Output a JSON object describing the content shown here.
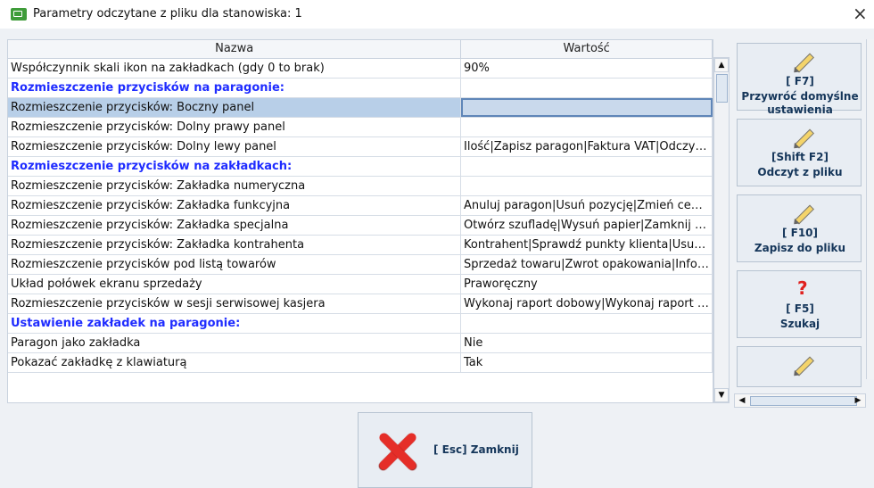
{
  "window": {
    "title": "Parametry odczytane z pliku dla stanowiska: 1",
    "close_label": "×"
  },
  "table": {
    "headers": [
      "Nazwa",
      "Wartość"
    ],
    "rows": [
      {
        "name": "Współczynnik skali ikon na zakładkach (gdy 0 to brak)",
        "value": "90%",
        "section": false,
        "selected": false
      },
      {
        "name": "Rozmieszczenie przycisków na paragonie:",
        "value": "",
        "section": true,
        "selected": false
      },
      {
        "name": "Rozmieszczenie przycisków: Boczny panel",
        "value": "",
        "section": false,
        "selected": true
      },
      {
        "name": "Rozmieszczenie przycisków: Dolny prawy panel",
        "value": "",
        "section": false,
        "selected": false
      },
      {
        "name": "Rozmieszczenie przycisków: Dolny lewy panel",
        "value": "Ilość|Zapisz paragon|Faktura VAT|Odczyt...",
        "section": false,
        "selected": false
      },
      {
        "name": "Rozmieszczenie przycisków na zakładkach:",
        "value": "",
        "section": true,
        "selected": false
      },
      {
        "name": "Rozmieszczenie przycisków: Zakładka numeryczna",
        "value": "",
        "section": false,
        "selected": false
      },
      {
        "name": "Rozmieszczenie przycisków: Zakładka funkcyjna",
        "value": "Anuluj paragon|Usuń pozycję|Zmień cen...",
        "section": false,
        "selected": false
      },
      {
        "name": "Rozmieszczenie przycisków: Zakładka specjalna",
        "value": "Otwórz szufladę|Wysuń papier|Zamknij z...",
        "section": false,
        "selected": false
      },
      {
        "name": "Rozmieszczenie przycisków: Zakładka kontrahenta",
        "value": "Kontrahent|Sprawdź punkty klienta|Usuń ...",
        "section": false,
        "selected": false
      },
      {
        "name": "Rozmieszczenie przycisków pod listą towarów",
        "value": "Sprzedaż towaru|Zwrot opakowania|Info ...",
        "section": false,
        "selected": false
      },
      {
        "name": "Układ połówek ekranu sprzedaży",
        "value": "Praworęczny",
        "section": false,
        "selected": false
      },
      {
        "name": "Rozmieszczenie przycisków w sesji serwisowej kasjera",
        "value": "Wykonaj raport dobowy|Wykonaj raport o...",
        "section": false,
        "selected": false
      },
      {
        "name": "Ustawienie zakładek na paragonie:",
        "value": "",
        "section": true,
        "selected": false
      },
      {
        "name": "Paragon jako zakładka",
        "value": "Nie",
        "section": false,
        "selected": false
      },
      {
        "name": "Pokazać zakładkę z klawiaturą",
        "value": "Tak",
        "section": false,
        "selected": false
      }
    ]
  },
  "actions": [
    {
      "key": "[ F7]",
      "label": "Przywróć domyślne ustawienia",
      "icon": "pencil-icon"
    },
    {
      "key": "[Shift F2]",
      "label": "Odczyt z pliku",
      "icon": "pencil-icon"
    },
    {
      "key": "[ F10]",
      "label": "Zapisz do pliku",
      "icon": "pencil-icon"
    },
    {
      "key": "[ F5]",
      "label": "Szukaj",
      "icon": "question-icon"
    }
  ],
  "close_button": {
    "label": "[ Esc] Zamknij",
    "icon": "close-x-icon"
  },
  "scroll": {
    "up": "▲",
    "down": "▼",
    "left": "◀",
    "right": "▶"
  },
  "colors": {
    "section_blue": "#1f2cff",
    "selected_blue": "#b8cfe8",
    "close_red": "#e52e28",
    "question_red": "#e0211f"
  }
}
